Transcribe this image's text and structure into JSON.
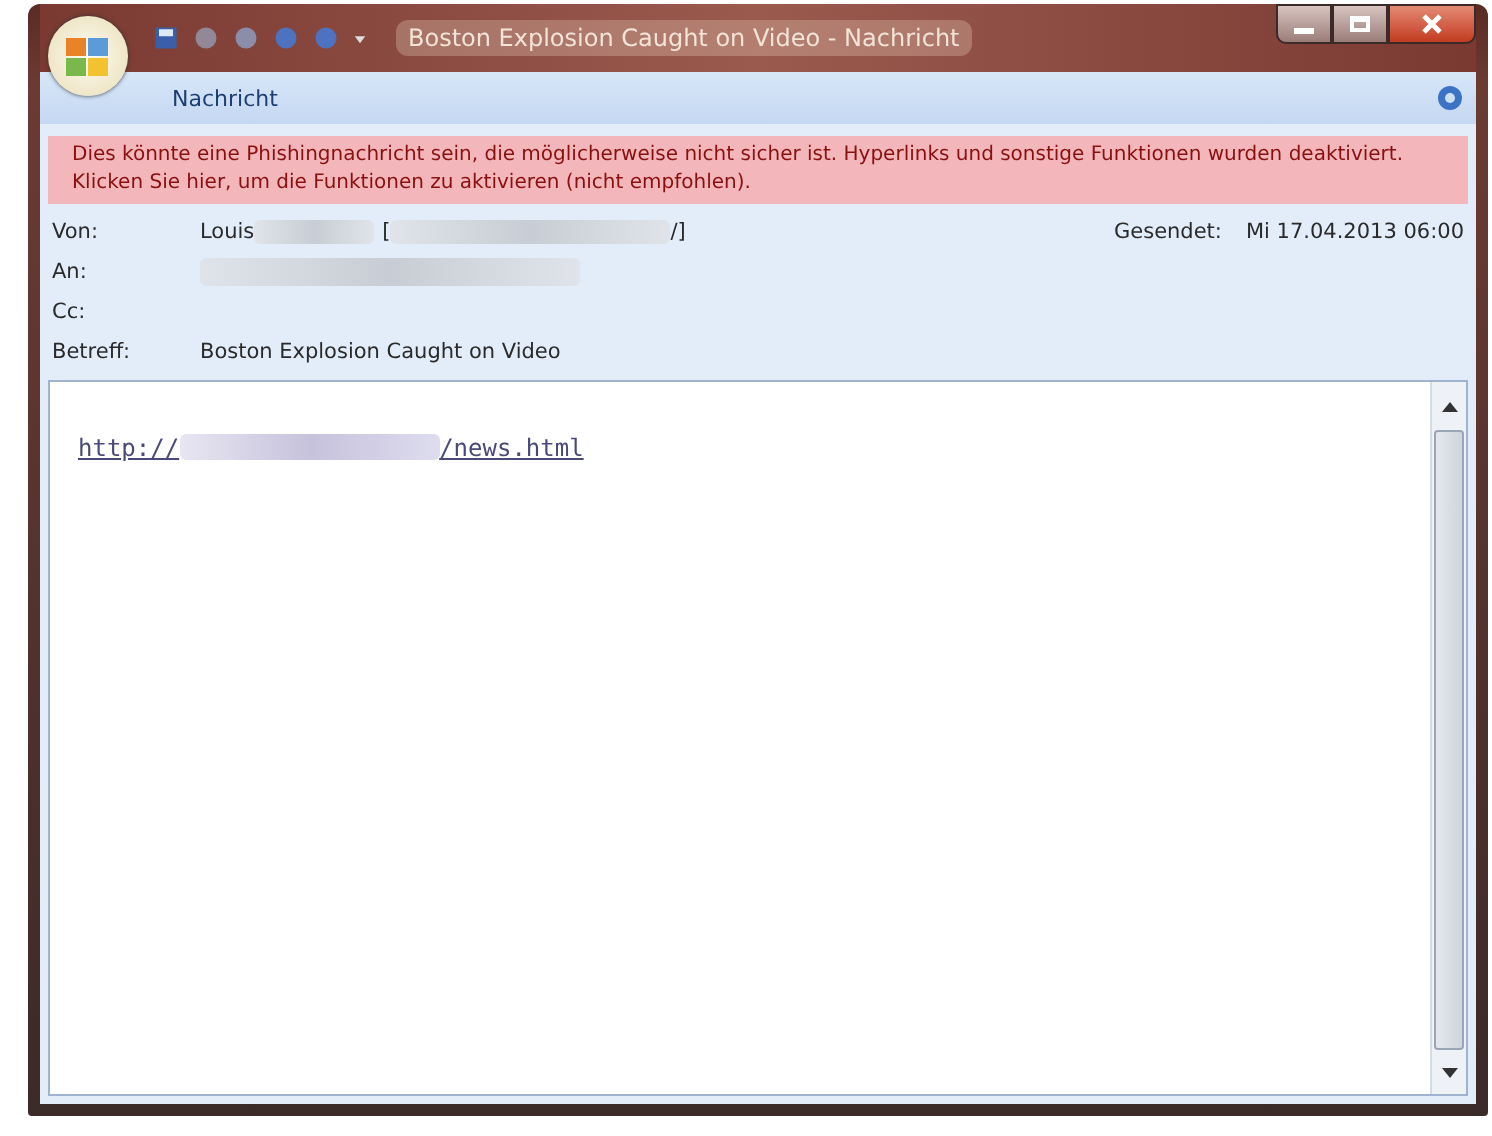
{
  "window": {
    "title": "Boston Explosion Caught on Video - Nachricht"
  },
  "ribbon": {
    "tab": "Nachricht"
  },
  "warning": "Dies könnte eine Phishingnachricht sein, die möglicherweise nicht sicher ist. Hyperlinks und sonstige Funktionen wurden deaktiviert. Klicken Sie hier, um die Funktionen zu aktivieren (nicht empfohlen).",
  "header": {
    "from_label": "Von:",
    "from_name": "Louis",
    "from_open": "[",
    "from_close": "/]",
    "sent_label": "Gesendet:",
    "sent_value": "Mi 17.04.2013 06:00",
    "to_label": "An:",
    "cc_label": "Cc:",
    "subject_label": "Betreff:",
    "subject": "Boston Explosion Caught on Video"
  },
  "body": {
    "link_start": "http://",
    "link_end": "/news.html"
  }
}
